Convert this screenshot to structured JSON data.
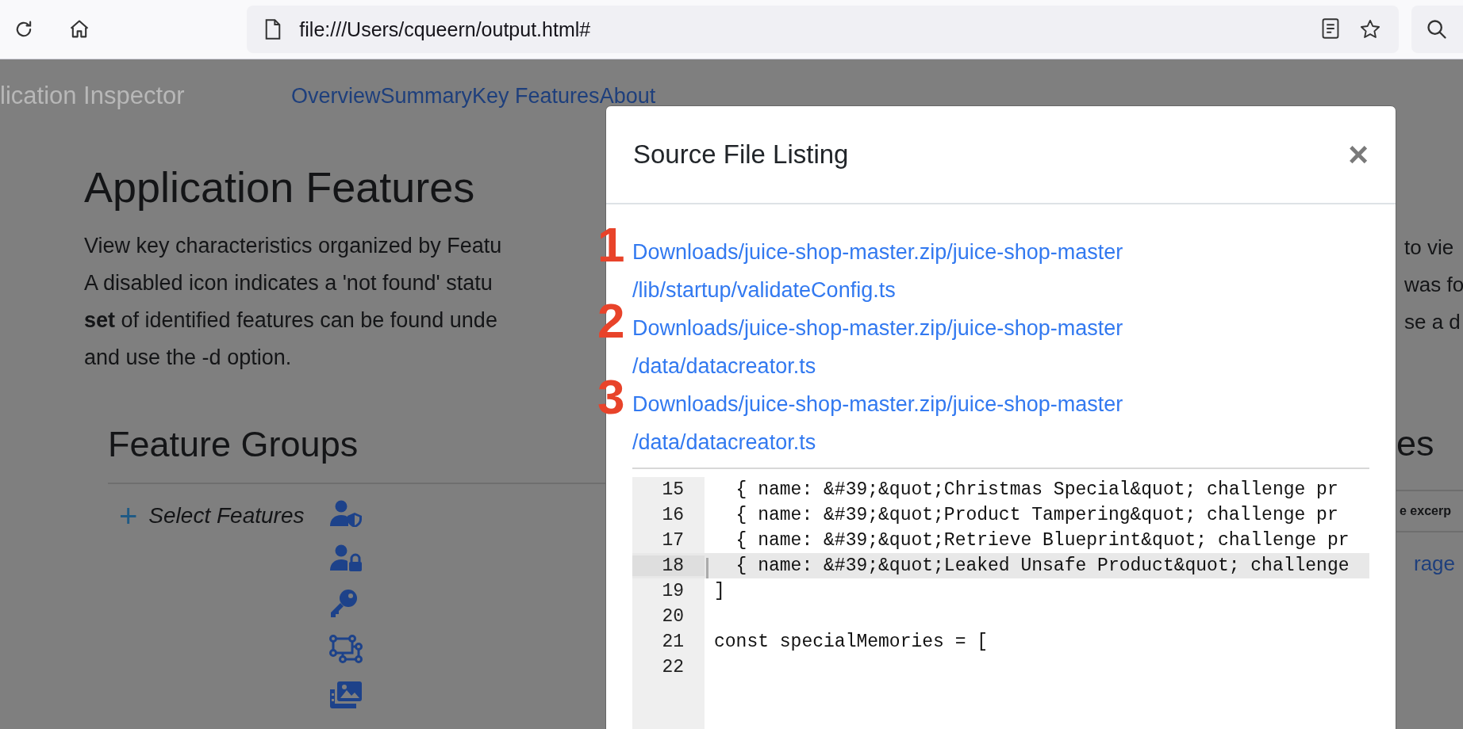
{
  "browser": {
    "url": "file:///Users/cqueern/output.html#"
  },
  "navbar": {
    "brand": "lication Inspector",
    "links": [
      "Overview",
      "Summary",
      "Key Features",
      "About"
    ]
  },
  "page": {
    "title": "Application Features",
    "intro_lines": [
      "View key characteristics organized by Featu",
      "A disabled icon indicates a 'not found' statu",
      "**set** of identified features can be found unde",
      "and use the -d option."
    ],
    "intro_fragments_right": [
      "to vie",
      "was fo",
      "se a d"
    ],
    "section_title": "Feature Groups",
    "select_features": {
      "icon": "+",
      "label": "Select Features"
    },
    "right_section_title": "es",
    "right_label": "e excerp",
    "right_link": "rage"
  },
  "modal": {
    "title": "Source File Listing",
    "close": "×",
    "files": [
      {
        "marker": "1",
        "lines": [
          "Downloads/juice-shop-master.zip/juice-shop-master",
          "/lib/startup/validateConfig.ts"
        ]
      },
      {
        "marker": "2",
        "lines": [
          "Downloads/juice-shop-master.zip/juice-shop-master",
          "/data/datacreator.ts"
        ]
      },
      {
        "marker": "3",
        "lines": [
          "Downloads/juice-shop-master.zip/juice-shop-master",
          "/data/datacreator.ts"
        ]
      }
    ],
    "code": {
      "lines": [
        {
          "number": "15",
          "text": "  { name: &#39;&quot;Christmas Special&quot; challenge pr",
          "selected": false
        },
        {
          "number": "16",
          "text": "  { name: &#39;&quot;Product Tampering&quot; challenge pr",
          "selected": false
        },
        {
          "number": "17",
          "text": "  { name: &#39;&quot;Retrieve Blueprint&quot; challenge pr",
          "selected": false
        },
        {
          "number": "18",
          "text": "  { name: &#39;&quot;Leaked Unsafe Product&quot; challenge",
          "selected": true
        },
        {
          "number": "19",
          "text": "]",
          "selected": false
        },
        {
          "number": "20",
          "selected": false
        },
        {
          "number": "21",
          "text": "const specialMemories = [",
          "selected": false
        },
        {
          "number": "22",
          "selected": false
        }
      ]
    }
  }
}
